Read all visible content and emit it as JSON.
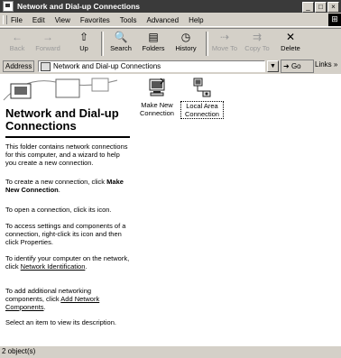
{
  "window": {
    "title": "Network and Dial-up Connections",
    "controls": [
      "_",
      "□",
      "×"
    ]
  },
  "menu": {
    "items": [
      "File",
      "Edit",
      "View",
      "Favorites",
      "Tools",
      "Advanced",
      "Help"
    ]
  },
  "toolbar": {
    "back": {
      "label": "Back",
      "icon": "←",
      "enabled": false
    },
    "forward": {
      "label": "Forward",
      "icon": "→",
      "enabled": false
    },
    "up": {
      "label": "Up",
      "icon": "⇧",
      "enabled": true
    },
    "search": {
      "label": "Search",
      "icon": "🔍",
      "enabled": true
    },
    "folders": {
      "label": "Folders",
      "icon": "▤",
      "enabled": true
    },
    "history": {
      "label": "History",
      "icon": "◷",
      "enabled": true
    },
    "move_to": {
      "label": "Move To",
      "icon": "⇢",
      "enabled": false
    },
    "copy_to": {
      "label": "Copy To",
      "icon": "⇉",
      "enabled": false
    },
    "delete": {
      "label": "Delete",
      "icon": "✕",
      "enabled": true
    }
  },
  "address": {
    "label": "Address",
    "value": "Network and Dial-up Connections",
    "go": "Go",
    "links": "Links »"
  },
  "panel": {
    "title": "Network and Dial-up Connections",
    "paragraphs": [
      "This folder contains network connections for this computer, and a wizard to help you create a new connection.",
      "To open a connection, click its icon.",
      "To access settings and components of a connection, right-click its icon and then click Properties."
    ],
    "create_prefix": "To create a new connection, click ",
    "create_bold": "Make New Connection",
    "create_suffix": ".",
    "identify_prefix": "To identify your computer on the network, click ",
    "identify_link": "Network Identification",
    "identify_suffix": ".",
    "addcomp_prefix": "To add additional networking components, click ",
    "addcomp_link": "Add Network Components",
    "addcomp_suffix": ".",
    "select_hint": "Select an item to view its description."
  },
  "icons": [
    {
      "label": "Make New Connection",
      "icon": "make-new-connection-icon",
      "selected": false
    },
    {
      "label": "Local Area Connection",
      "icon": "local-area-connection-icon",
      "selected": true
    }
  ],
  "status": {
    "text": "2 object(s)"
  }
}
